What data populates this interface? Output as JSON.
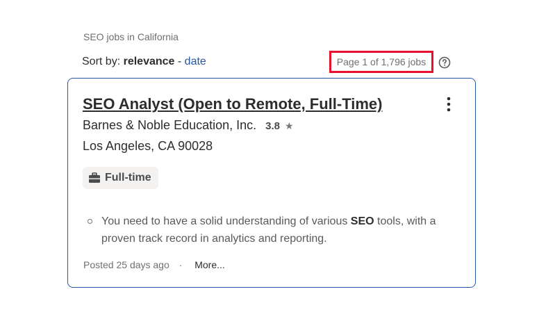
{
  "search": {
    "heading": "SEO jobs in California"
  },
  "sort": {
    "prefix": "Sort by:",
    "active": "relevance",
    "separator": "-",
    "alternate": "date"
  },
  "pagination": {
    "text": "Page 1 of 1,796 jobs",
    "help_icon": "question-circle-icon"
  },
  "job": {
    "title": "SEO Analyst (Open to Remote, Full-Time)",
    "company": "Barnes & Noble Education, Inc.",
    "rating": "3.8",
    "location": "Los Angeles, CA 90028",
    "job_type": "Full-time",
    "snippet_before": "You need to have a solid understanding of various ",
    "snippet_bold": "SEO",
    "snippet_after": " tools, with a proven track record in analytics and reporting.",
    "posted": "Posted 25 days ago",
    "separator": "·",
    "more": "More..."
  },
  "colors": {
    "accent": "#2557a7",
    "highlight_box": "#e8112d",
    "text": "#2d2d2d",
    "muted": "#6f6f6f"
  }
}
